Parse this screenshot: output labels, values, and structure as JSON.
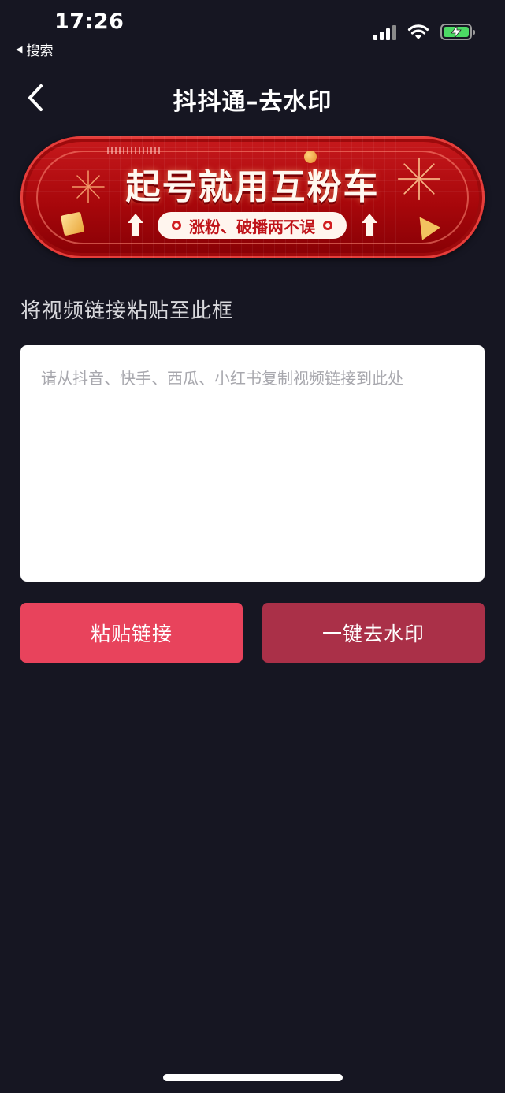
{
  "status_bar": {
    "time": "17:26",
    "back_app": "搜索",
    "back_arrow_icon": "back-triangle-icon",
    "signal_icon": "cellular-signal-icon",
    "wifi_icon": "wifi-icon",
    "battery_icon": "battery-charging-icon",
    "battery_color": "#4cd964"
  },
  "nav": {
    "back_icon": "chevron-left-icon",
    "title": "抖抖通–去水印"
  },
  "banner": {
    "headline": "起号就用互粉车",
    "pill_text": "涨粉、破播两不误",
    "colors": {
      "background": "#b00f12",
      "pill": "#fff5ee",
      "text": "#c0141a"
    }
  },
  "form": {
    "prompt": "将视频链接粘贴至此框",
    "input_value": "",
    "input_placeholder": "请从抖音、快手、西瓜、小红书复制视频链接到此处"
  },
  "buttons": {
    "paste_label": "粘贴链接",
    "paste_color": "#e8435c",
    "remove_label": "一键去水印",
    "remove_color": "#aa3048"
  },
  "theme": {
    "background": "#161622"
  }
}
